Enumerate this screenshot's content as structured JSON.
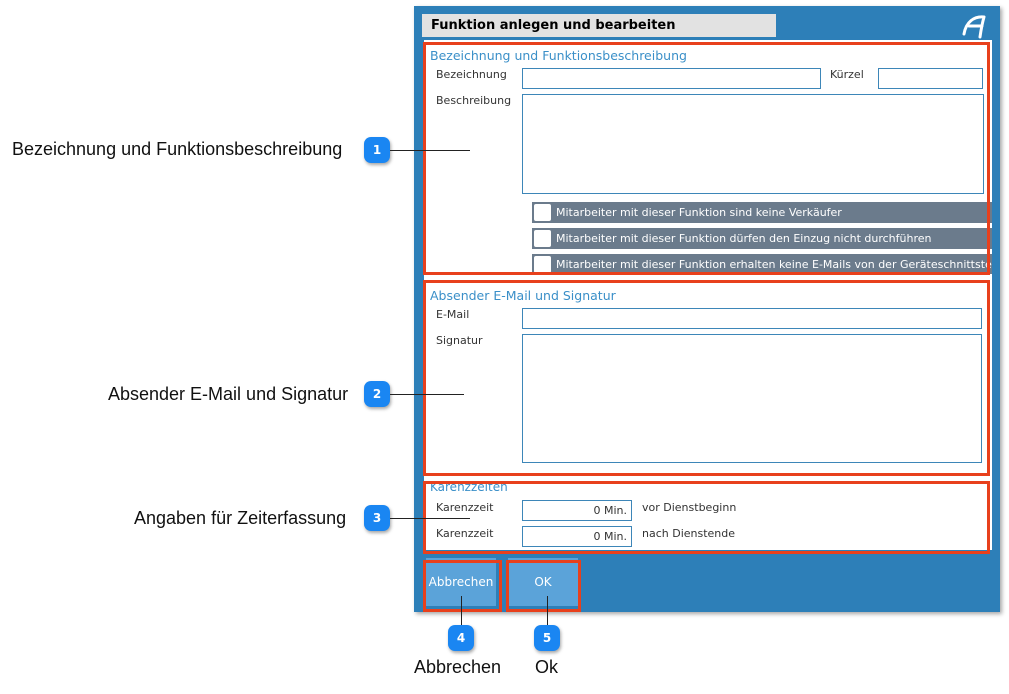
{
  "dialog": {
    "title": "Funktion anlegen und bearbeiten",
    "logo_icon": "app-logo-icon"
  },
  "section1": {
    "title": "Bezeichnung und Funktionsbeschreibung",
    "label_bezeichnung": "Bezeichnung",
    "value_bezeichnung": "",
    "label_kuerzel": "Kürzel",
    "value_kuerzel": "",
    "label_beschreibung": "Beschreibung",
    "value_beschreibung": "",
    "checkboxes": [
      {
        "label": "Mitarbeiter mit dieser Funktion sind keine Verkäufer",
        "checked": false
      },
      {
        "label": "Mitarbeiter mit dieser Funktion dürfen den Einzug nicht durchführen",
        "checked": false
      },
      {
        "label": "Mitarbeiter mit dieser Funktion erhalten keine E-Mails von der Geräteschnittstelle",
        "checked": false
      }
    ]
  },
  "section2": {
    "title": "Absender E-Mail und Signatur",
    "label_email": "E-Mail",
    "value_email": "",
    "label_signatur": "Signatur",
    "value_signatur": ""
  },
  "section3": {
    "title": "Karenzzeiten",
    "rows": [
      {
        "label": "Karenzzeit",
        "value": "0 Min.",
        "suffix": "vor Dienstbeginn"
      },
      {
        "label": "Karenzzeit",
        "value": "0 Min.",
        "suffix": "nach Dienstende"
      }
    ]
  },
  "buttons": {
    "cancel": "Abbrechen",
    "ok": "OK"
  },
  "annotations": [
    {
      "number": "1",
      "text": "Bezeichnung und Funktionsbeschreibung"
    },
    {
      "number": "2",
      "text": "Absender E-Mail und Signatur"
    },
    {
      "number": "3",
      "text": "Angaben für Zeiterfassung"
    },
    {
      "number": "4",
      "text": "Abbrechen"
    },
    {
      "number": "5",
      "text": "Ok"
    }
  ],
  "colors": {
    "dialog_blue": "#2d7fb8",
    "highlight_red": "#e8401c",
    "marker_blue": "#1a86f2",
    "button_blue": "#5ba3d9",
    "checkbox_row": "#6b7b8c"
  }
}
